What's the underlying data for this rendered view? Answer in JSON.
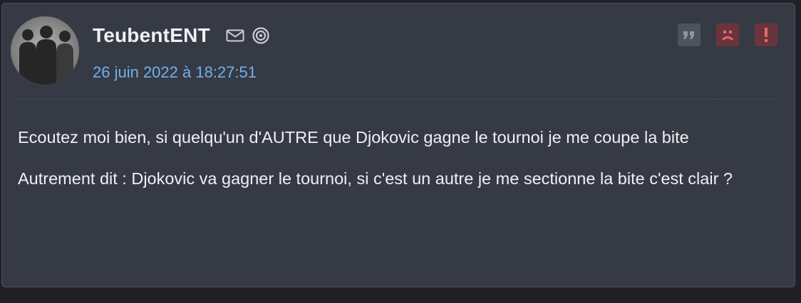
{
  "post": {
    "author": {
      "username": "TeubentENT",
      "avatar_icon": "group-silhouette-avatar"
    },
    "date": "26 juin 2022 à 18:27:51",
    "header_icons": [
      "mail-icon",
      "spiral-icon"
    ],
    "actions": [
      {
        "name": "quote",
        "icon": "quote-icon",
        "color": "#4d525d"
      },
      {
        "name": "dislike",
        "icon": "sad-face-icon",
        "color": "#6b343a"
      },
      {
        "name": "report",
        "icon": "exclamation-icon",
        "color": "#6b343a"
      }
    ],
    "content": {
      "paragraphs": [
        "Ecoutez moi bien, si quelqu'un d'AUTRE que Djokovic gagne le tournoi je me coupe la bite",
        "Autrement dit : Djokovic va gagner le tournoi, si c'est un autre je me sectionne la bite c'est clair ?"
      ]
    }
  },
  "colors": {
    "background": "#1f2127",
    "card": "#363a45",
    "date_link": "#6fb2ea",
    "text": "#eef0f3"
  }
}
